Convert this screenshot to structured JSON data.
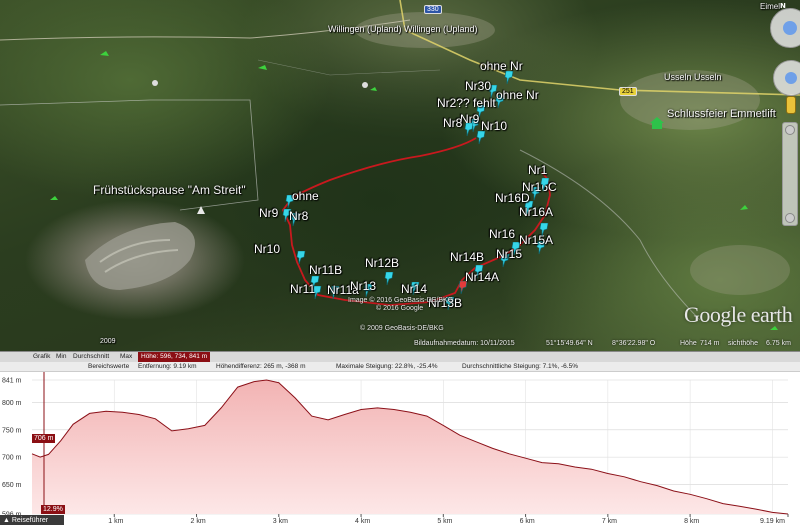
{
  "places": {
    "willingen": "Willingen (Upland)  Willingen (Upland)",
    "usseln": "Usseln  Usseln",
    "schlussfeier": "Schlussfeier Emmetlift",
    "fruehstueck": "Frühstückspause \"Am Streit\"",
    "eimel": "Eimel",
    "road_330": "330",
    "road_251": "251",
    "bottom_left": "2009"
  },
  "pins": [
    {
      "label": "ohne Nr"
    },
    {
      "label": "Nr30"
    },
    {
      "label": "ohne Nr"
    },
    {
      "label": "Nr2?? fehlt"
    },
    {
      "label": "Nr9"
    },
    {
      "label": "Nr8"
    },
    {
      "label": "Nr10"
    },
    {
      "label": "ohne"
    },
    {
      "label": "Nr9"
    },
    {
      "label": "Nr8"
    },
    {
      "label": "Nr10"
    },
    {
      "label": "Nr11B"
    },
    {
      "label": "Nr11"
    },
    {
      "label": "Nr11a"
    },
    {
      "label": "Nr12B"
    },
    {
      "label": "Nr13"
    },
    {
      "label": "Nr14"
    },
    {
      "label": "Nr13B"
    },
    {
      "label": "Nr14B"
    },
    {
      "label": "Nr14A"
    },
    {
      "label": "Nr15"
    },
    {
      "label": "Nr16"
    },
    {
      "label": "Nr15A"
    },
    {
      "label": "Nr16A"
    },
    {
      "label": "Nr16D"
    },
    {
      "label": "Nr16C"
    },
    {
      "label": "Nr1"
    }
  ],
  "map_footer": {
    "copyright_1": "Image © 2016 GeoBasis-DE/BKG",
    "copyright_2": "© 2016 Google",
    "copyright_3": "© 2009 GeoBasis-DE/BKG",
    "logo": "Google earth",
    "imagery_date": "Bildaufnahmedatum: 10/11/2015",
    "lat": "51°15'49.64\" N",
    "lon": "8°36'22.98\" O",
    "elev_label": "Höhe",
    "elev_value": "714 m",
    "eye_label": "sichthöhe",
    "eye_value": "6.75 km"
  },
  "elevation": {
    "toolbar": {
      "grafik": "Grafik",
      "min": "Min",
      "avg": "Durchschnitt",
      "max": "Max",
      "hoehe": "Höhe: 596, 734, 841 m"
    },
    "stats": {
      "bereich": "Bereichswerte",
      "entfernung": "Entfernung: 9.19 km",
      "hoehendiff": "Höhendifferenz: 265 m, -368 m",
      "steigung_max": "Maximale Steigung: 22.8%, -25.4%",
      "steigung_avg": "Durchschnittliche Steigung: 7.1%, -6.5%"
    },
    "current_elev": "706 m",
    "current_grade": "12.9%",
    "tour_guide": "Reiseführer",
    "y_ticks": [
      "841 m",
      "800 m",
      "750 m",
      "700 m",
      "650 m",
      "596 m"
    ],
    "x_ticks": [
      "1 km",
      "2 km",
      "3 km",
      "4 km",
      "5 km",
      "6 km",
      "7 km",
      "8 km",
      "9.19 km"
    ]
  },
  "chart_data": {
    "type": "area",
    "title": "",
    "xlabel": "",
    "ylabel": "",
    "xlim": [
      0,
      9.19
    ],
    "ylim": [
      596,
      841
    ],
    "x": [
      0,
      0.1,
      0.2,
      0.35,
      0.5,
      0.7,
      0.9,
      1.1,
      1.3,
      1.5,
      1.7,
      1.9,
      2.1,
      2.3,
      2.5,
      2.7,
      2.85,
      3.0,
      3.2,
      3.4,
      3.6,
      3.8,
      4.0,
      4.2,
      4.4,
      4.6,
      4.8,
      5.0,
      5.2,
      5.4,
      5.6,
      5.8,
      6.0,
      6.2,
      6.4,
      6.6,
      6.8,
      7.0,
      7.2,
      7.4,
      7.6,
      7.8,
      8.0,
      8.2,
      8.4,
      8.6,
      8.8,
      9.0,
      9.19
    ],
    "values": [
      706,
      700,
      705,
      730,
      760,
      780,
      784,
      782,
      778,
      770,
      748,
      752,
      758,
      790,
      828,
      838,
      841,
      836,
      808,
      775,
      768,
      778,
      787,
      790,
      787,
      782,
      775,
      758,
      740,
      728,
      716,
      706,
      698,
      690,
      688,
      682,
      678,
      670,
      664,
      655,
      648,
      638,
      632,
      624,
      615,
      610,
      605,
      599,
      596
    ],
    "series_color": "#8b1018",
    "fill_top": "#f2b3b3",
    "fill_bottom": "#fde7e7",
    "grid": true
  }
}
